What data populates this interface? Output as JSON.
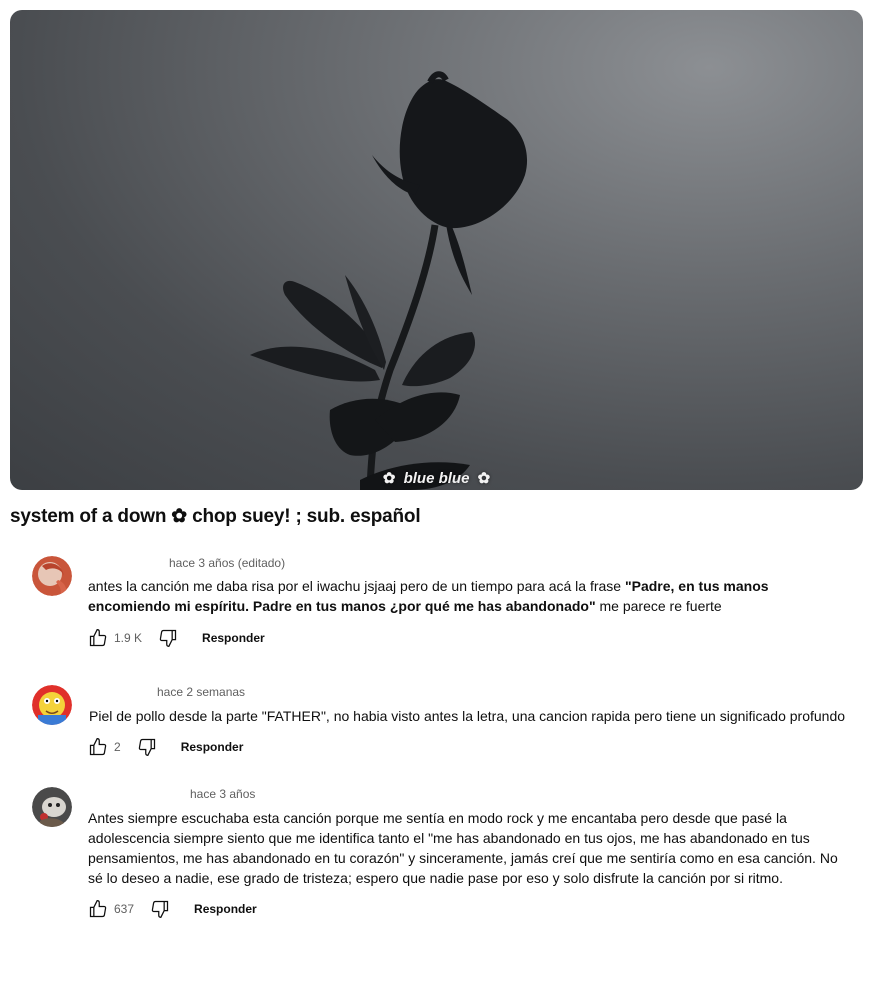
{
  "video": {
    "caption_text": "blue blue",
    "caption_flower": "✿",
    "title": "system of a down ✿ chop suey! ; sub. español"
  },
  "comments": [
    {
      "time": "hace 3 años (editado)",
      "text_plain": "antes la canción me daba risa por el iwachu jsjaaj pero de un tiempo para acá la frase ",
      "text_bold": "\"Padre, en tus manos encomiendo mi espíritu. Padre en tus manos ¿por qué me has abandonado\"",
      "text_tail": " me parece re fuerte",
      "likes": "1.9 K",
      "reply_label": "Responder"
    },
    {
      "time": "hace 2 semanas",
      "text_plain": "Piel de pollo desde la parte \"FATHER\", no habia visto antes la letra, una cancion rapida pero tiene un significado profundo",
      "likes": "2",
      "reply_label": "Responder"
    },
    {
      "time": "hace 3 años",
      "text_plain": "Antes siempre escuchaba esta canción porque me sentía en modo rock y me encantaba pero desde que pasé la adolescencia siempre siento que me identifica tanto el \"me has abandonado en tus ojos, me has abandonado en tus pensamientos, me has abandonado en tu corazón\" y sinceramente, jamás creí que me sentiría como en esa canción. No sé lo deseo a nadie, ese grado de tristeza; espero que nadie pase por eso y solo disfrute la canción por si ritmo.",
      "likes": "637",
      "reply_label": "Responder"
    }
  ],
  "icons": {
    "like": "thumbs-up-icon",
    "dislike": "thumbs-down-icon"
  }
}
